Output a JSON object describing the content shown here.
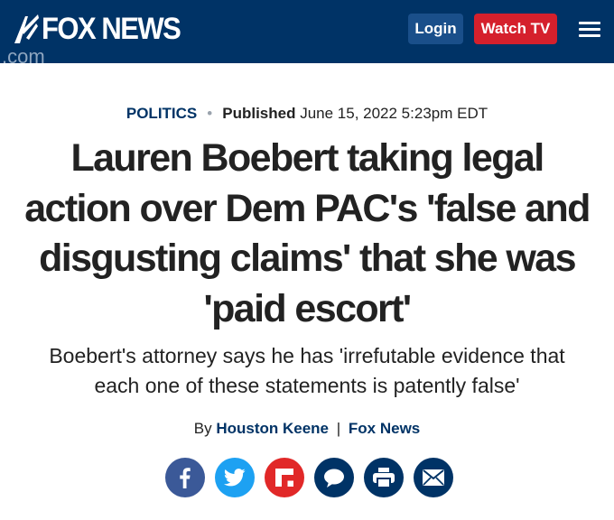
{
  "header": {
    "logo_text": "FOX NEWS",
    "logo_suffix": ".com",
    "login_label": "Login",
    "watch_label": "Watch TV",
    "menu_icon": "hamburger-menu-icon"
  },
  "colors": {
    "header_bg": "#003366",
    "login_bg": "#1a4f8a",
    "watch_bg": "#d5202c",
    "facebook": "#3b5998",
    "twitter": "#1da1f2",
    "flipboard": "#e12828",
    "comments": "#003366",
    "print": "#003366",
    "email": "#003366"
  },
  "article": {
    "category": "POLITICS",
    "published_label": "Published",
    "published_date": "June 15, 2022 5:23pm EDT",
    "headline_lines": [
      "Lauren Boebert taking legal",
      "action over Dem PAC's 'false and",
      "disgusting claims' that she was",
      "'paid escort'"
    ],
    "subheadline_lines": [
      "Boebert's attorney says he has 'irrefutable evidence that",
      "each one of these statements is patently false'"
    ],
    "byline_prefix": "By",
    "author": "Houston Keene",
    "byline_separator": "|",
    "outlet": "Fox News"
  },
  "share": [
    {
      "name": "facebook-icon"
    },
    {
      "name": "twitter-icon"
    },
    {
      "name": "flipboard-icon"
    },
    {
      "name": "comments-icon"
    },
    {
      "name": "print-icon"
    },
    {
      "name": "email-icon"
    }
  ]
}
